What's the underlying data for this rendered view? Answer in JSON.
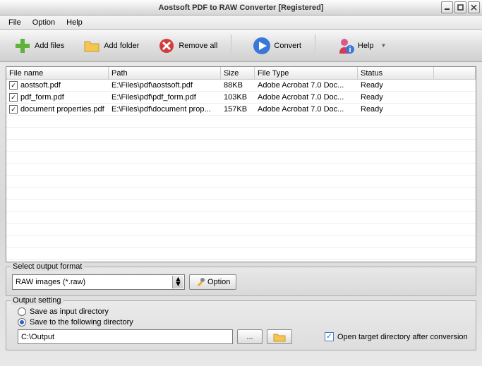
{
  "window": {
    "title": "Aostsoft PDF to RAW Converter [Registered]"
  },
  "menu": {
    "file": "File",
    "option": "Option",
    "help": "Help"
  },
  "toolbar": {
    "add_files": "Add files",
    "add_folder": "Add folder",
    "remove_all": "Remove all",
    "convert": "Convert",
    "help": "Help"
  },
  "table": {
    "headers": {
      "name": "File name",
      "path": "Path",
      "size": "Size",
      "type": "File Type",
      "status": "Status"
    },
    "rows": [
      {
        "checked": true,
        "name": "aostsoft.pdf",
        "path": "E:\\Files\\pdf\\aostsoft.pdf",
        "size": "88KB",
        "type": "Adobe Acrobat 7.0 Doc...",
        "status": "Ready"
      },
      {
        "checked": true,
        "name": "pdf_form.pdf",
        "path": "E:\\Files\\pdf\\pdf_form.pdf",
        "size": "103KB",
        "type": "Adobe Acrobat 7.0 Doc...",
        "status": "Ready"
      },
      {
        "checked": true,
        "name": "document properties.pdf",
        "path": "E:\\Files\\pdf\\document prop...",
        "size": "157KB",
        "type": "Adobe Acrobat 7.0 Doc...",
        "status": "Ready"
      }
    ]
  },
  "format": {
    "legend": "Select output format",
    "value": "RAW images (*.raw)",
    "option_btn": "Option"
  },
  "output": {
    "legend": "Output setting",
    "same_dir": "Save as input directory",
    "custom_dir": "Save to the following directory",
    "path": "C:\\Output",
    "browse": "...",
    "open_after": "Open target directory after conversion"
  }
}
